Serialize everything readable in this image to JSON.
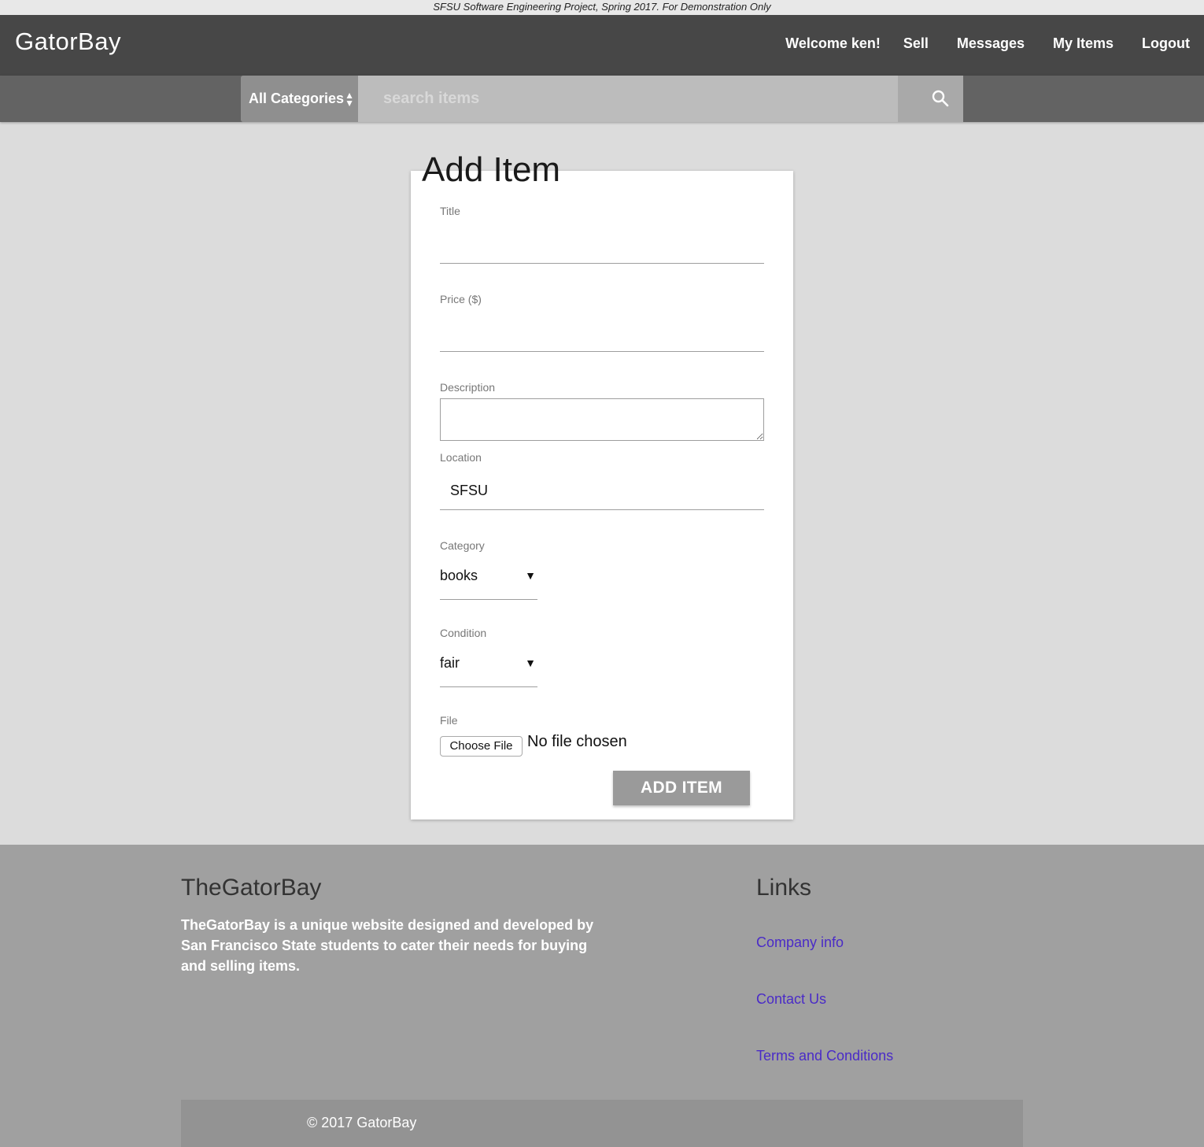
{
  "banner": {
    "text": "SFSU Software Engineering Project, Spring 2017. For Demonstration Only"
  },
  "navbar": {
    "brand": "GatorBay",
    "welcome": "Welcome ken!",
    "links": [
      "Sell",
      "Messages",
      "My Items",
      "Logout"
    ]
  },
  "search": {
    "category": "All Categories",
    "placeholder": "search items"
  },
  "form": {
    "title": "Add Item",
    "fields": {
      "title_label": "Title",
      "title_value": "",
      "price_label": "Price ($)",
      "price_value": "",
      "description_label": "Description",
      "description_value": "",
      "location_label": "Location",
      "location_value": "SFSU",
      "category_label": "Category",
      "category_value": "books",
      "condition_label": "Condition",
      "condition_value": "fair",
      "file_label": "File",
      "file_button": "Choose File",
      "file_status": "No file chosen"
    },
    "submit_label": "ADD ITEM"
  },
  "footer": {
    "about_heading": "TheGatorBay",
    "about_text": "TheGatorBay is a unique website designed and developed by San Francisco State students to cater their needs for buying and selling items.",
    "links_heading": "Links",
    "links": [
      "Company info",
      "Contact Us",
      "Terms and Conditions"
    ],
    "copyright": "© 2017 GatorBay"
  },
  "colors": {
    "navbar": "#474747",
    "searchbar": "#636363",
    "page_bg": "#dcdcdc",
    "footer": "#a0a0a0",
    "footer_link": "#4a2bc7",
    "button": "#9a9a9a"
  },
  "icons": {
    "search": "search-icon"
  }
}
